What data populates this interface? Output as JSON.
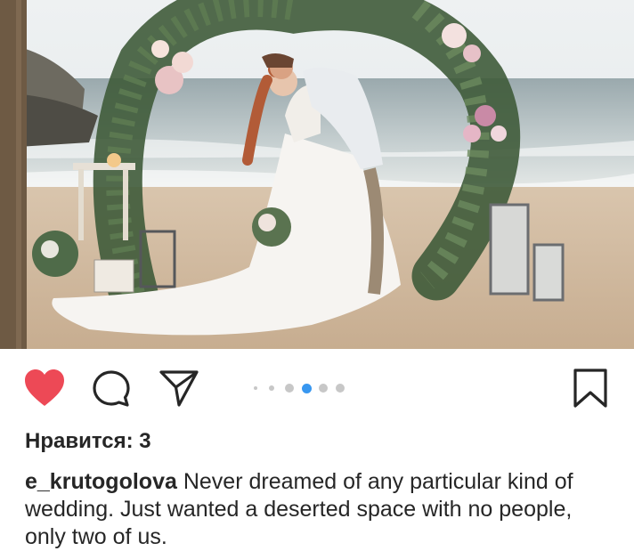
{
  "post": {
    "photo_alt": "wedding photo on beach",
    "carousel": {
      "count": 5,
      "active_index": 2
    },
    "likes_label": "Нравится: 3",
    "caption_user": "e_krutogolova",
    "caption_text": "Never dreamed of any particular kind of wedding. Just wanted a deserted space with no people, only two of us."
  },
  "icons": {
    "like": "heart-filled-icon",
    "comment": "comment-bubble-icon",
    "share": "paper-plane-icon",
    "save": "bookmark-icon"
  },
  "colors": {
    "like_red": "#ed4956",
    "active_dot": "#3897f0",
    "inactive_dot": "#c7c7c7",
    "text": "#262626"
  }
}
